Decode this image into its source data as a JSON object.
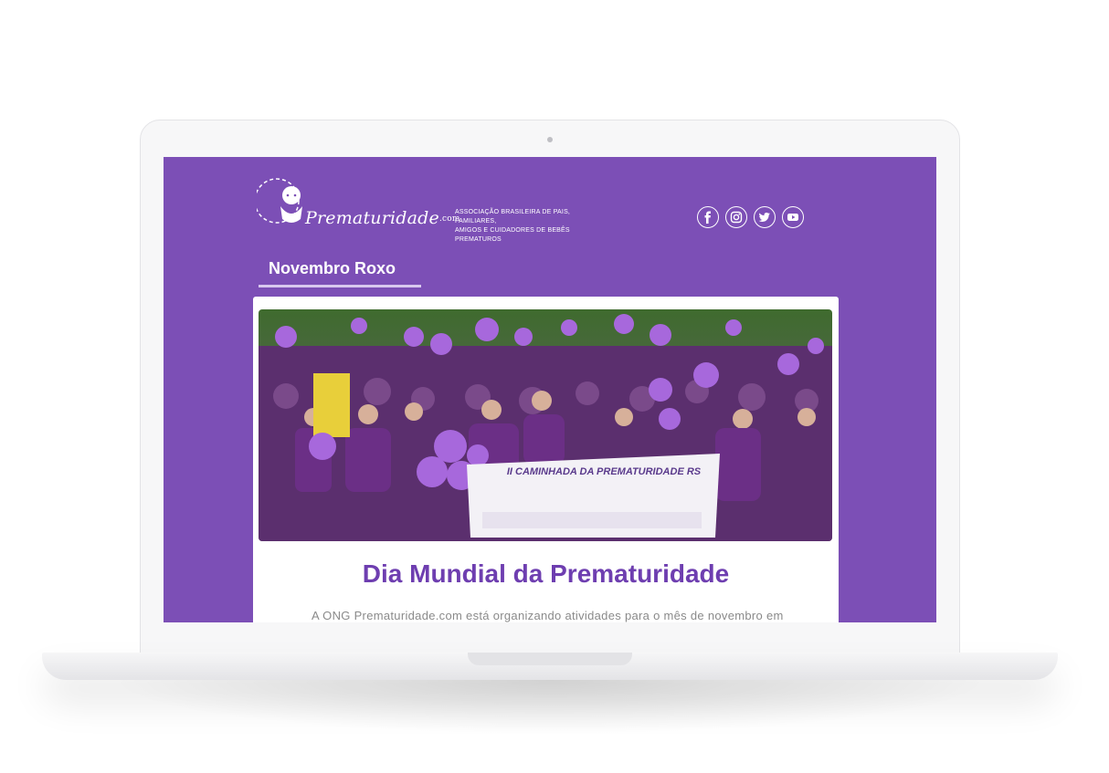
{
  "header": {
    "logo_name": "Prematuridade",
    "logo_suffix": ".com",
    "tagline_line1": "ASSOCIAÇÃO BRASILEIRA DE PAIS, FAMILIARES,",
    "tagline_line2": "AMIGOS E CUIDADORES DE BEBÊS PREMATUROS",
    "social": [
      {
        "icon": "facebook-icon",
        "label": "f"
      },
      {
        "icon": "instagram-icon",
        "label": ""
      },
      {
        "icon": "twitter-icon",
        "label": ""
      },
      {
        "icon": "youtube-icon",
        "label": ""
      }
    ]
  },
  "section": {
    "title": "Novembro Roxo"
  },
  "article": {
    "banner_text": "II CAMINHADA DA PREMATURIDADE RS",
    "headline": "Dia Mundial da Prematuridade",
    "body": "A ONG Prematuridade.com está organizando atividades para o mês de novembro em"
  },
  "colors": {
    "brand_purple": "#7c4fb6",
    "headline_purple": "#6e3eb0",
    "balloon": "#a768dc"
  }
}
